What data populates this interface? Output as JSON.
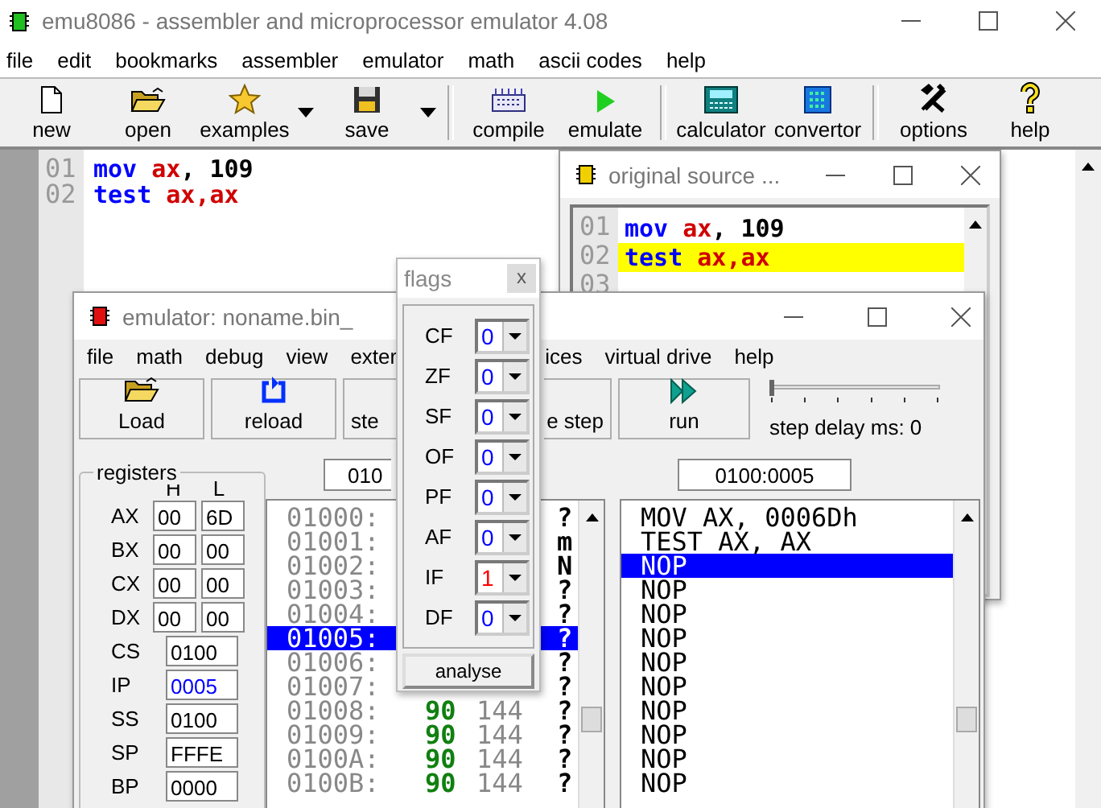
{
  "window": {
    "title": "emu8086 - assembler and microprocessor emulator 4.08"
  },
  "menu": [
    "file",
    "edit",
    "bookmarks",
    "assembler",
    "emulator",
    "math",
    "ascii codes",
    "help"
  ],
  "toolbar": [
    {
      "label": "new",
      "dropdown": false,
      "separator_before": false
    },
    {
      "label": "open",
      "dropdown": false,
      "separator_before": false
    },
    {
      "label": "examples",
      "dropdown": true,
      "separator_before": false
    },
    {
      "label": "save",
      "dropdown": true,
      "separator_before": false
    },
    {
      "label": "compile",
      "dropdown": false,
      "separator_before": true
    },
    {
      "label": "emulate",
      "dropdown": false,
      "separator_before": false
    },
    {
      "label": "calculator",
      "dropdown": false,
      "separator_before": true
    },
    {
      "label": "convertor",
      "dropdown": false,
      "separator_before": false
    },
    {
      "label": "options",
      "dropdown": false,
      "separator_before": true
    },
    {
      "label": "help",
      "dropdown": false,
      "separator_before": false
    }
  ],
  "editor": {
    "lines": [
      {
        "number": "01",
        "tokens": [
          {
            "kind": "keyword",
            "text": "mov "
          },
          {
            "kind": "register",
            "text": "ax"
          },
          {
            "kind": "plain",
            "text": ", 109"
          }
        ]
      },
      {
        "number": "02",
        "tokens": [
          {
            "kind": "keyword",
            "text": "test "
          },
          {
            "kind": "register",
            "text": "ax,ax"
          }
        ]
      }
    ]
  },
  "source_window": {
    "title": "original source ...",
    "lines": [
      {
        "number": "01",
        "selected": false,
        "tokens": [
          {
            "kind": "keyword",
            "text": "mov "
          },
          {
            "kind": "register",
            "text": "ax"
          },
          {
            "kind": "plain",
            "text": ", 109"
          }
        ]
      },
      {
        "number": "02",
        "selected": true,
        "tokens": [
          {
            "kind": "keyword",
            "text": "test "
          },
          {
            "kind": "register",
            "text": "ax,ax"
          }
        ]
      },
      {
        "number": "03",
        "selected": false
      }
    ]
  },
  "emulator": {
    "title": "emulator: noname.bin_",
    "menu": [
      "file",
      "math",
      "debug",
      "view",
      "exter",
      "ices",
      "virtual drive",
      "help"
    ],
    "buttons": [
      {
        "label": "Load"
      },
      {
        "label": "reload"
      },
      {
        "label": "ste"
      },
      {
        "label": "e step"
      },
      {
        "label": "run"
      }
    ],
    "step_delay": {
      "level": 0,
      "label": "step delay ms: 0"
    },
    "registers": {
      "title": "registers",
      "high_header": "H",
      "low_header": "L",
      "general": [
        {
          "name": "AX",
          "high": "00",
          "low": "6D"
        },
        {
          "name": "BX",
          "high": "00",
          "low": "00"
        },
        {
          "name": "CX",
          "high": "00",
          "low": "00"
        },
        {
          "name": "DX",
          "high": "00",
          "low": "00"
        }
      ],
      "segment": [
        {
          "name": "CS",
          "value": "0100",
          "changed": false
        },
        {
          "name": "IP",
          "value": "0005",
          "changed": true
        },
        {
          "name": "SS",
          "value": "0100",
          "changed": false
        },
        {
          "name": "SP",
          "value": "FFFE",
          "changed": false
        },
        {
          "name": "BP",
          "value": "0000",
          "changed": false
        }
      ]
    },
    "memory": {
      "address": "010",
      "rows": [
        {
          "address": "01000:",
          "char": "?",
          "selected": false
        },
        {
          "address": "01001:",
          "char": "m",
          "selected": false
        },
        {
          "address": "01002:",
          "char": "N",
          "selected": false
        },
        {
          "address": "01003:",
          "char": "?",
          "selected": false
        },
        {
          "address": "01004:",
          "char": "?",
          "selected": false
        },
        {
          "address": "01005:",
          "char": "?",
          "selected": true
        },
        {
          "address": "01006:",
          "char": "?",
          "selected": false
        },
        {
          "address": "01007:",
          "char": "?",
          "selected": false
        },
        {
          "address": "01008:",
          "hex": "90",
          "decimal": "144",
          "char": "?",
          "selected": false
        },
        {
          "address": "01009:",
          "hex": "90",
          "decimal": "144",
          "char": "?",
          "selected": false
        },
        {
          "address": "0100A:",
          "hex": "90",
          "decimal": "144",
          "char": "?",
          "selected": false
        },
        {
          "address": "0100B:",
          "hex": "90",
          "decimal": "144",
          "char": "?",
          "selected": false
        }
      ]
    },
    "disassembly": {
      "address": "0100:0005",
      "rows": [
        {
          "text": "MOV AX, 0006Dh",
          "selected": false
        },
        {
          "text": "TEST AX, AX",
          "selected": false
        },
        {
          "text": "NOP",
          "selected": true
        },
        {
          "text": "NOP",
          "selected": false
        },
        {
          "text": "NOP",
          "selected": false
        },
        {
          "text": "NOP",
          "selected": false
        },
        {
          "text": "NOP",
          "selected": false
        },
        {
          "text": "NOP",
          "selected": false
        },
        {
          "text": "NOP",
          "selected": false
        },
        {
          "text": "NOP",
          "selected": false
        },
        {
          "text": "NOP",
          "selected": false
        },
        {
          "text": "NOP",
          "selected": false
        }
      ]
    }
  },
  "flags": {
    "title": "flags",
    "close": "x",
    "list": [
      {
        "name": "CF",
        "value": "0",
        "set": false
      },
      {
        "name": "ZF",
        "value": "0",
        "set": false
      },
      {
        "name": "SF",
        "value": "0",
        "set": false
      },
      {
        "name": "OF",
        "value": "0",
        "set": false
      },
      {
        "name": "PF",
        "value": "0",
        "set": false
      },
      {
        "name": "AF",
        "value": "0",
        "set": false
      },
      {
        "name": "IF",
        "value": "1",
        "set": true
      },
      {
        "name": "DF",
        "value": "0",
        "set": false
      }
    ],
    "button": "analyse"
  }
}
